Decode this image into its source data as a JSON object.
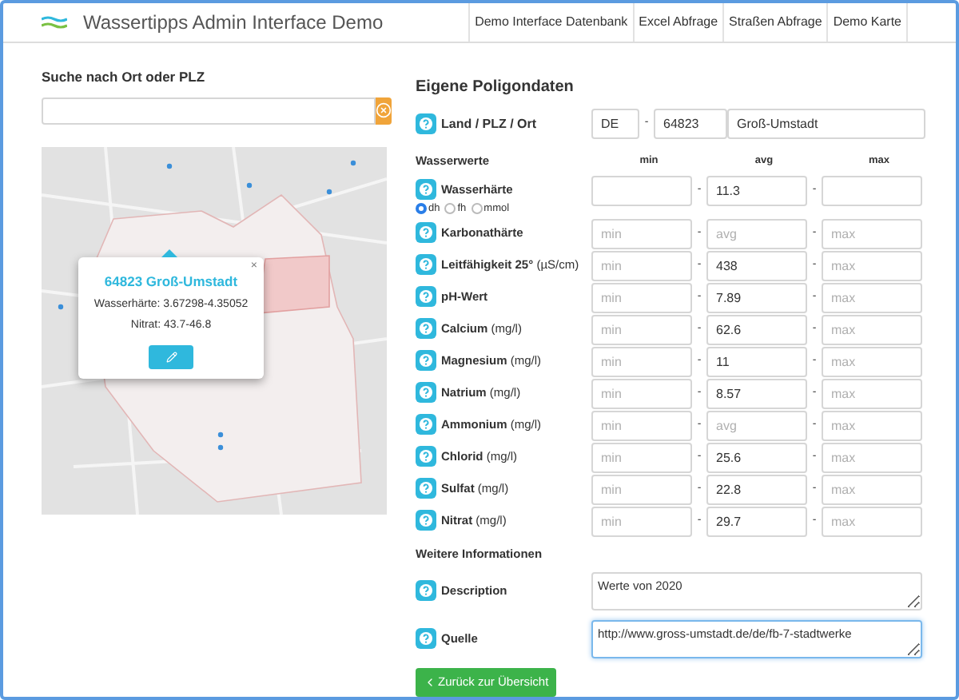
{
  "header": {
    "title": "Wassertipps Admin Interface Demo",
    "nav": [
      {
        "label": "Demo Interface Datenbank"
      },
      {
        "label": "Excel Abfrage"
      },
      {
        "label": "Straßen Abfrage"
      },
      {
        "label": "Demo Karte"
      }
    ]
  },
  "search": {
    "label": "Suche nach Ort oder PLZ"
  },
  "map_popup": {
    "title": "64823 Groß-Umstadt",
    "lines": [
      "Wasserhärte: 3.67298-4.35052",
      "Nitrat: 43.7-46.8"
    ],
    "close": "×"
  },
  "form": {
    "title": "Eigene Poligondaten",
    "location": {
      "label": "Land / PLZ / Ort",
      "country": "DE",
      "zip": "64823",
      "city": "Groß-Umstadt"
    },
    "separator": "-",
    "values_heading": "Wasserwerte",
    "columns": [
      "min",
      "avg",
      "max"
    ],
    "rows": [
      {
        "label": "Wasserhärte",
        "units": [
          {
            "label": "dh",
            "selected": true
          },
          {
            "label": "fh",
            "selected": false
          },
          {
            "label": "mmol",
            "selected": false
          }
        ],
        "fields": {
          "avg": {
            "value": "11.3"
          }
        }
      },
      {
        "label": "Karbonathärte",
        "fields": {
          "min": {
            "placeholder": "min"
          },
          "avg": {
            "placeholder": "avg"
          },
          "max": {
            "placeholder": "max"
          }
        }
      },
      {
        "label": "**Leitfähigkeit 25°** (µS/cm)",
        "fields": {
          "min": {
            "placeholder": "min"
          },
          "avg": {
            "value": "438"
          },
          "max": {
            "placeholder": "max"
          }
        }
      },
      {
        "label": "pH-Wert",
        "fields": {
          "min": {
            "placeholder": "min"
          },
          "avg": {
            "value": "7.89"
          },
          "max": {
            "placeholder": "max"
          }
        }
      },
      {
        "label": "**Calcium** (mg/l)",
        "fields": {
          "min": {
            "placeholder": "min"
          },
          "avg": {
            "value": "62.6"
          },
          "max": {
            "placeholder": "max"
          }
        }
      },
      {
        "label": "**Magnesium** (mg/l)",
        "fields": {
          "min": {
            "placeholder": "min"
          },
          "avg": {
            "value": "11"
          },
          "max": {
            "placeholder": "max"
          }
        }
      },
      {
        "label": "**Natrium** (mg/l)",
        "fields": {
          "min": {
            "placeholder": "min"
          },
          "avg": {
            "value": "8.57"
          },
          "max": {
            "placeholder": "max"
          }
        }
      },
      {
        "label": "**Ammonium** (mg/l)",
        "fields": {
          "min": {
            "placeholder": "min"
          },
          "avg": {
            "placeholder": "avg"
          },
          "max": {
            "placeholder": "max"
          }
        }
      },
      {
        "label": "**Chlorid** (mg/l)",
        "fields": {
          "min": {
            "placeholder": "min"
          },
          "avg": {
            "value": "25.6"
          },
          "max": {
            "placeholder": "max"
          }
        }
      },
      {
        "label": "**Sulfat** (mg/l)",
        "fields": {
          "min": {
            "placeholder": "min"
          },
          "avg": {
            "value": "22.8"
          },
          "max": {
            "placeholder": "max"
          }
        }
      },
      {
        "label": "**Nitrat** (mg/l)",
        "fields": {
          "min": {
            "placeholder": "min"
          },
          "avg": {
            "value": "29.7"
          },
          "max": {
            "placeholder": "max"
          }
        }
      }
    ],
    "more_heading": "Weitere Informationen",
    "extra": [
      {
        "label": "Description",
        "value": "Werte von 2020",
        "focused": false
      },
      {
        "label": "Quelle",
        "value": "http://www.gross-umstadt.de/de/fb-7-stadtwerke",
        "focused": true
      }
    ],
    "back_button": "Zurück zur Übersicht"
  }
}
